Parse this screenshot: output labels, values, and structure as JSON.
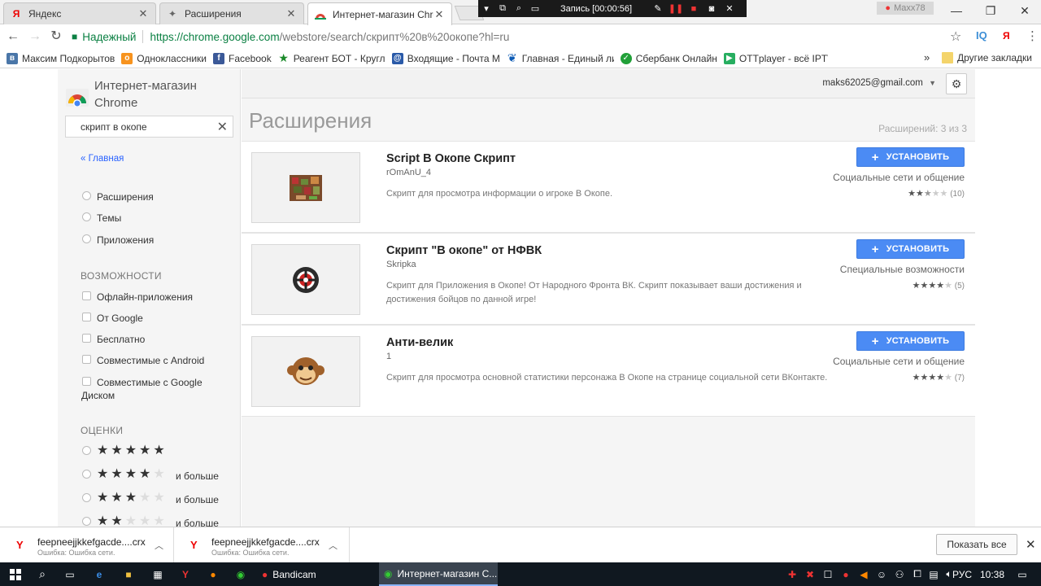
{
  "tabs": [
    {
      "title": "Яндекс",
      "icon": "yandex-icon"
    },
    {
      "title": "Расширения",
      "icon": "puzzle-icon"
    },
    {
      "title": "Интернет-магазин Chro",
      "icon": "chrome-store-icon"
    }
  ],
  "recorder": {
    "label": "Запись [00:00:56]"
  },
  "profile_name": "Maxx78",
  "window_buttons": [
    "—",
    "❐",
    "✕"
  ],
  "toolbar": {
    "secure_label": "Надежный",
    "url_host": "https://chrome.google.com",
    "url_path": "/webstore/search/скрипт%20в%20окопе?hl=ru"
  },
  "bookmarks": [
    {
      "label": "Максим Подкорытов",
      "icon": "vk-icon",
      "color": "#4a76a8"
    },
    {
      "label": "Одноклассники",
      "icon": "ok-icon",
      "color": "#f7931e"
    },
    {
      "label": "Facebook",
      "icon": "facebook-icon",
      "color": "#3b5998"
    },
    {
      "label": "Реагент БОТ - Круглс",
      "icon": "star-icon",
      "color": "#1b8a2a"
    },
    {
      "label": "Входящие - Почта М",
      "icon": "mail-icon",
      "color": "#2a5aa8"
    },
    {
      "label": "Главная - Единый ли",
      "icon": "gosuslugi-icon",
      "color": "#0d5bb5"
    },
    {
      "label": "Сбербанк Онлайн",
      "icon": "sberbank-icon",
      "color": "#21a038"
    },
    {
      "label": "OTTplayer - всё IPTV",
      "icon": "ottplayer-icon",
      "color": "#27ae60"
    }
  ],
  "bookmarks_more": "»",
  "other_bookmarks": "Другие закладки",
  "store": {
    "title_line1": "Интернет-магазин",
    "title_line2": "Chrome",
    "search_value": "скрипт в окопе",
    "home_link": "« Главная",
    "types": [
      "Расширения",
      "Темы",
      "Приложения"
    ],
    "features_heading": "ВОЗМОЖНОСТИ",
    "features": [
      "Офлайн-приложения",
      "От Google",
      "Бесплатно",
      "Совместимые с Android",
      "Совместимые с Google",
      "Диском"
    ],
    "ratings_heading": "ОЦЕНКИ",
    "ratings_more": "и больше",
    "rating_levels": [
      5,
      4,
      3,
      2
    ],
    "account_email": "maks62025@gmail.com",
    "heading": "Расширения",
    "count": "Расширений: 3 из 3"
  },
  "items": [
    {
      "name": "Script В Окопе Скрипт",
      "author": "rOmAnU_4",
      "description": "Скрипт для просмотра информации о игроке В Окопе.",
      "category": "Социальные сети и общение",
      "rating": 2.5,
      "reviews": "(10)",
      "install_label": "УСТАНОВИТЬ"
    },
    {
      "name": "Скрипт \"В окопе\" от НФВК",
      "author": "Skripka",
      "description": "Скрипт для Приложения в Окопе! От Народного Фронта ВК. Скрипт показывает ваши достижения и достижения бойцов по данной игре!",
      "category": "Специальные возможности",
      "rating": 4,
      "reviews": "(5)",
      "install_label": "УСТАНОВИТЬ"
    },
    {
      "name": "Анти-велик",
      "author": "1",
      "description": "Скрипт для просмотра основной статистики персонажа В Окопе на странице социальной сети ВКонтакте.",
      "category": "Социальные сети и общение",
      "rating": 4,
      "reviews": "(7)",
      "install_label": "УСТАНОВИТЬ"
    }
  ],
  "downloads": [
    {
      "file": "feepneejjkkefgacde....crx",
      "status": "Ошибка: Ошибка сети."
    },
    {
      "file": "feepneejjkkefgacde....crx",
      "status": "Ошибка: Ошибка сети."
    }
  ],
  "show_all": "Показать все",
  "taskbar": {
    "apps": [
      "Bandicam",
      "Интернет-магазин С..."
    ],
    "lang": "РУС",
    "time": "10:38"
  }
}
